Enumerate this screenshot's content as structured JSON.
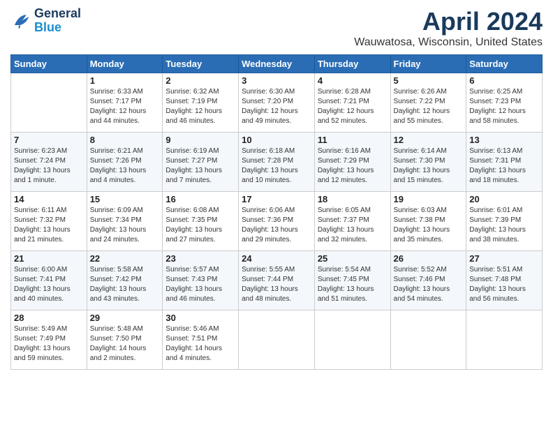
{
  "header": {
    "logo_line1": "General",
    "logo_line2": "Blue",
    "title": "April 2024",
    "subtitle": "Wauwatosa, Wisconsin, United States"
  },
  "columns": [
    "Sunday",
    "Monday",
    "Tuesday",
    "Wednesday",
    "Thursday",
    "Friday",
    "Saturday"
  ],
  "weeks": [
    [
      {
        "day": "",
        "info": ""
      },
      {
        "day": "1",
        "info": "Sunrise: 6:33 AM\nSunset: 7:17 PM\nDaylight: 12 hours\nand 44 minutes."
      },
      {
        "day": "2",
        "info": "Sunrise: 6:32 AM\nSunset: 7:19 PM\nDaylight: 12 hours\nand 46 minutes."
      },
      {
        "day": "3",
        "info": "Sunrise: 6:30 AM\nSunset: 7:20 PM\nDaylight: 12 hours\nand 49 minutes."
      },
      {
        "day": "4",
        "info": "Sunrise: 6:28 AM\nSunset: 7:21 PM\nDaylight: 12 hours\nand 52 minutes."
      },
      {
        "day": "5",
        "info": "Sunrise: 6:26 AM\nSunset: 7:22 PM\nDaylight: 12 hours\nand 55 minutes."
      },
      {
        "day": "6",
        "info": "Sunrise: 6:25 AM\nSunset: 7:23 PM\nDaylight: 12 hours\nand 58 minutes."
      }
    ],
    [
      {
        "day": "7",
        "info": "Sunrise: 6:23 AM\nSunset: 7:24 PM\nDaylight: 13 hours\nand 1 minute."
      },
      {
        "day": "8",
        "info": "Sunrise: 6:21 AM\nSunset: 7:26 PM\nDaylight: 13 hours\nand 4 minutes."
      },
      {
        "day": "9",
        "info": "Sunrise: 6:19 AM\nSunset: 7:27 PM\nDaylight: 13 hours\nand 7 minutes."
      },
      {
        "day": "10",
        "info": "Sunrise: 6:18 AM\nSunset: 7:28 PM\nDaylight: 13 hours\nand 10 minutes."
      },
      {
        "day": "11",
        "info": "Sunrise: 6:16 AM\nSunset: 7:29 PM\nDaylight: 13 hours\nand 12 minutes."
      },
      {
        "day": "12",
        "info": "Sunrise: 6:14 AM\nSunset: 7:30 PM\nDaylight: 13 hours\nand 15 minutes."
      },
      {
        "day": "13",
        "info": "Sunrise: 6:13 AM\nSunset: 7:31 PM\nDaylight: 13 hours\nand 18 minutes."
      }
    ],
    [
      {
        "day": "14",
        "info": "Sunrise: 6:11 AM\nSunset: 7:32 PM\nDaylight: 13 hours\nand 21 minutes."
      },
      {
        "day": "15",
        "info": "Sunrise: 6:09 AM\nSunset: 7:34 PM\nDaylight: 13 hours\nand 24 minutes."
      },
      {
        "day": "16",
        "info": "Sunrise: 6:08 AM\nSunset: 7:35 PM\nDaylight: 13 hours\nand 27 minutes."
      },
      {
        "day": "17",
        "info": "Sunrise: 6:06 AM\nSunset: 7:36 PM\nDaylight: 13 hours\nand 29 minutes."
      },
      {
        "day": "18",
        "info": "Sunrise: 6:05 AM\nSunset: 7:37 PM\nDaylight: 13 hours\nand 32 minutes."
      },
      {
        "day": "19",
        "info": "Sunrise: 6:03 AM\nSunset: 7:38 PM\nDaylight: 13 hours\nand 35 minutes."
      },
      {
        "day": "20",
        "info": "Sunrise: 6:01 AM\nSunset: 7:39 PM\nDaylight: 13 hours\nand 38 minutes."
      }
    ],
    [
      {
        "day": "21",
        "info": "Sunrise: 6:00 AM\nSunset: 7:41 PM\nDaylight: 13 hours\nand 40 minutes."
      },
      {
        "day": "22",
        "info": "Sunrise: 5:58 AM\nSunset: 7:42 PM\nDaylight: 13 hours\nand 43 minutes."
      },
      {
        "day": "23",
        "info": "Sunrise: 5:57 AM\nSunset: 7:43 PM\nDaylight: 13 hours\nand 46 minutes."
      },
      {
        "day": "24",
        "info": "Sunrise: 5:55 AM\nSunset: 7:44 PM\nDaylight: 13 hours\nand 48 minutes."
      },
      {
        "day": "25",
        "info": "Sunrise: 5:54 AM\nSunset: 7:45 PM\nDaylight: 13 hours\nand 51 minutes."
      },
      {
        "day": "26",
        "info": "Sunrise: 5:52 AM\nSunset: 7:46 PM\nDaylight: 13 hours\nand 54 minutes."
      },
      {
        "day": "27",
        "info": "Sunrise: 5:51 AM\nSunset: 7:48 PM\nDaylight: 13 hours\nand 56 minutes."
      }
    ],
    [
      {
        "day": "28",
        "info": "Sunrise: 5:49 AM\nSunset: 7:49 PM\nDaylight: 13 hours\nand 59 minutes."
      },
      {
        "day": "29",
        "info": "Sunrise: 5:48 AM\nSunset: 7:50 PM\nDaylight: 14 hours\nand 2 minutes."
      },
      {
        "day": "30",
        "info": "Sunrise: 5:46 AM\nSunset: 7:51 PM\nDaylight: 14 hours\nand 4 minutes."
      },
      {
        "day": "",
        "info": ""
      },
      {
        "day": "",
        "info": ""
      },
      {
        "day": "",
        "info": ""
      },
      {
        "day": "",
        "info": ""
      }
    ]
  ]
}
